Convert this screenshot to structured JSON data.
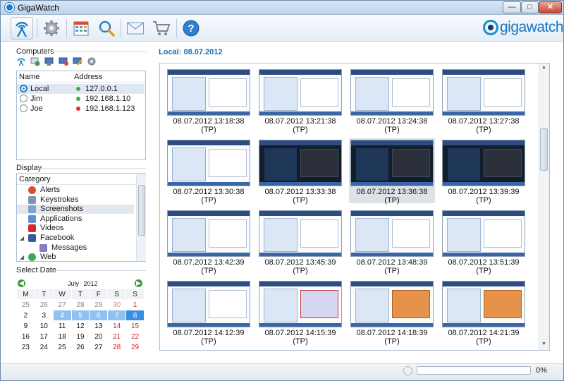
{
  "app": {
    "title": "GigaWatch",
    "logo_text": "gigawatch"
  },
  "window_controls": {
    "minimize": "—",
    "maximize": "□",
    "close": "✕"
  },
  "toolbar": {
    "buttons": [
      {
        "name": "computers-button",
        "icon": "antenna-icon"
      },
      {
        "name": "settings-button",
        "icon": "gear-icon"
      },
      {
        "name": "reports-button",
        "icon": "calendar-grid-icon"
      },
      {
        "name": "search-button",
        "icon": "magnifier-icon"
      },
      {
        "name": "mail-button",
        "icon": "envelope-icon"
      },
      {
        "name": "shop-button",
        "icon": "cart-icon"
      },
      {
        "name": "help-button",
        "icon": "help-icon",
        "label": "?"
      }
    ]
  },
  "computers": {
    "heading": "Computers",
    "columns": {
      "name": "Name",
      "address": "Address"
    },
    "rows": [
      {
        "name": "Local",
        "address": "127.0.0.1",
        "status_color": "#3cb043",
        "selected": true
      },
      {
        "name": "Jim",
        "address": "192.168.1.10",
        "status_color": "#3cb043",
        "selected": false
      },
      {
        "name": "Joe",
        "address": "192.168.1.123",
        "status_color": "#e03030",
        "selected": false
      }
    ]
  },
  "display": {
    "heading": "Display",
    "column": "Category",
    "items": [
      {
        "label": "Alerts",
        "icon": "alert-icon",
        "color": "#e04a2f"
      },
      {
        "label": "Keystrokes",
        "icon": "keyboard-icon",
        "color": "#7f95b3"
      },
      {
        "label": "Screenshots",
        "icon": "screenshot-icon",
        "color": "#7aa4d6",
        "selected": true
      },
      {
        "label": "Applications",
        "icon": "window-icon",
        "color": "#5b8fcf"
      },
      {
        "label": "Videos",
        "icon": "youtube-icon",
        "color": "#d22b2b"
      },
      {
        "label": "Facebook",
        "icon": "facebook-icon",
        "color": "#3b5998",
        "expander": "◢"
      },
      {
        "label": "Messages",
        "icon": "chat-icon",
        "color": "#8c7bc4"
      },
      {
        "label": "Web",
        "icon": "globe-icon",
        "color": "#3aa65a",
        "expander": "◢"
      }
    ]
  },
  "calendar": {
    "heading": "Select Date",
    "month": "July",
    "year": "2012",
    "weekdays": [
      "M",
      "T",
      "W",
      "T",
      "F",
      "S",
      "S"
    ],
    "weeks": [
      [
        "25",
        "26",
        "27",
        "28",
        "29",
        "30",
        "1"
      ],
      [
        "2",
        "3",
        "4",
        "5",
        "6",
        "7",
        "8"
      ],
      [
        "9",
        "10",
        "11",
        "12",
        "13",
        "14",
        "15"
      ],
      [
        "16",
        "17",
        "18",
        "19",
        "20",
        "21",
        "22"
      ],
      [
        "23",
        "24",
        "25",
        "26",
        "27",
        "28",
        "29"
      ]
    ],
    "selected_range": [
      "4",
      "5",
      "6",
      "7",
      "8"
    ],
    "selected_day": "8"
  },
  "gallery": {
    "title": "Local: 08.07.2012",
    "items": [
      {
        "time": "08.07.2012 13:18:38",
        "tag": "(TP)",
        "style": "light"
      },
      {
        "time": "08.07.2012 13:21:38",
        "tag": "(TP)",
        "style": "light"
      },
      {
        "time": "08.07.2012 13:24:38",
        "tag": "(TP)",
        "style": "light"
      },
      {
        "time": "08.07.2012 13:27:38",
        "tag": "(TP)",
        "style": "light"
      },
      {
        "time": "08.07.2012 13:30:38",
        "tag": "(TP)",
        "style": "light"
      },
      {
        "time": "08.07.2012 13:33:38",
        "tag": "(TP)",
        "style": "dark"
      },
      {
        "time": "08.07.2012 13:36:38",
        "tag": "(TP)",
        "style": "dark",
        "selected": true
      },
      {
        "time": "08.07.2012 13:39:39",
        "tag": "(TP)",
        "style": "dark"
      },
      {
        "time": "08.07.2012 13:42:39",
        "tag": "(TP)",
        "style": "light"
      },
      {
        "time": "08.07.2012 13:45:39",
        "tag": "(TP)",
        "style": "light"
      },
      {
        "time": "08.07.2012 13:48:39",
        "tag": "(TP)",
        "style": "light"
      },
      {
        "time": "08.07.2012 13:51:39",
        "tag": "(TP)",
        "style": "light"
      },
      {
        "time": "08.07.2012 14:12:39",
        "tag": "(TP)",
        "style": "light"
      },
      {
        "time": "08.07.2012 14:15:39",
        "tag": "(TP)",
        "style": "red"
      },
      {
        "time": "08.07.2012 14:18:39",
        "tag": "(TP)",
        "style": "orange"
      },
      {
        "time": "08.07.2012 14:21:39",
        "tag": "(TP)",
        "style": "orange"
      }
    ]
  },
  "status": {
    "progress_fraction": 0,
    "progress_text": "0%"
  }
}
